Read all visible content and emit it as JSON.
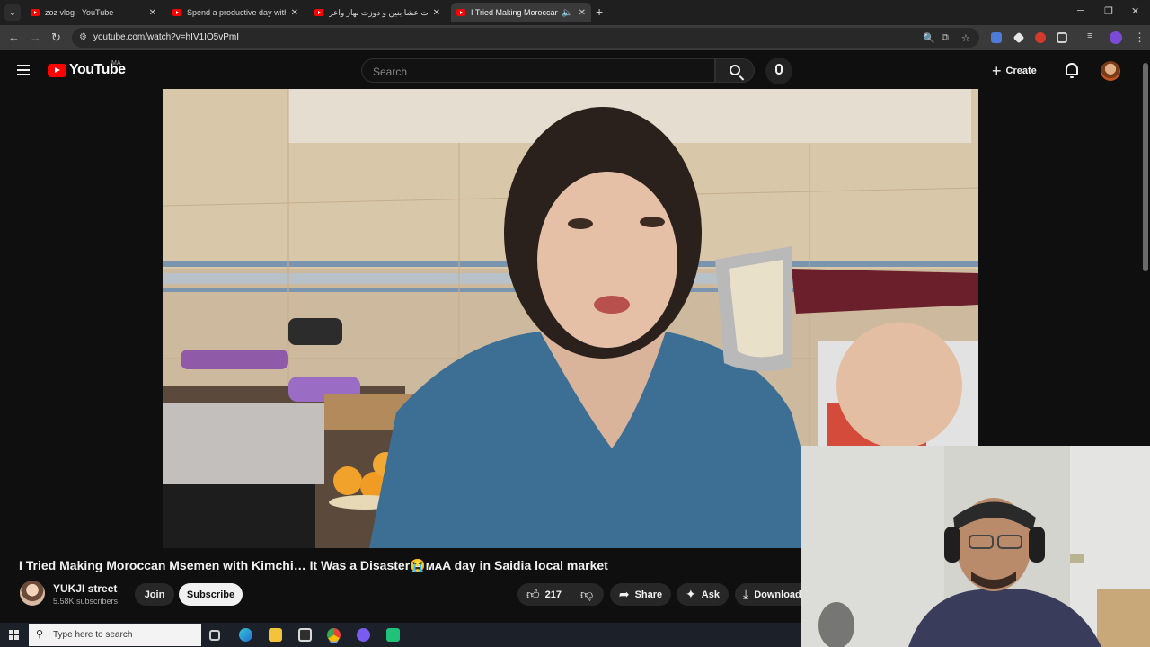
{
  "browser": {
    "tabs": [
      {
        "title": "zoz vlog - YouTube",
        "active": false
      },
      {
        "title": "Spend a productive day with m",
        "active": false
      },
      {
        "title": "طبيت عشا بنين و دوزت نهار واعر",
        "active": false
      },
      {
        "title": "I Tried Making Moroccan M",
        "active": true
      }
    ],
    "url": "youtube.com/watch?v=hIV1IO5vPmI"
  },
  "youtube": {
    "logo_text": "YouTube",
    "country_code": "MA",
    "search_placeholder": "Search",
    "create_label": "Create"
  },
  "video": {
    "title": "I Tried Making Moroccan Msemen with Kimchi… It Was a Disaster😭ᴍᴀA day in Saidia local market",
    "channel_name": "YUKJI street",
    "subscribers": "5.58K subscribers",
    "join_label": "Join",
    "subscribe_label": "Subscribe",
    "likes": "217",
    "share_label": "Share",
    "ask_label": "Ask",
    "download_label": "Download"
  },
  "taskbar": {
    "search_placeholder": "Type here to search"
  },
  "colors": {
    "youtube_red": "#ff0000",
    "background": "#0f0f0f",
    "sweater_blue": "#3d6f95"
  }
}
